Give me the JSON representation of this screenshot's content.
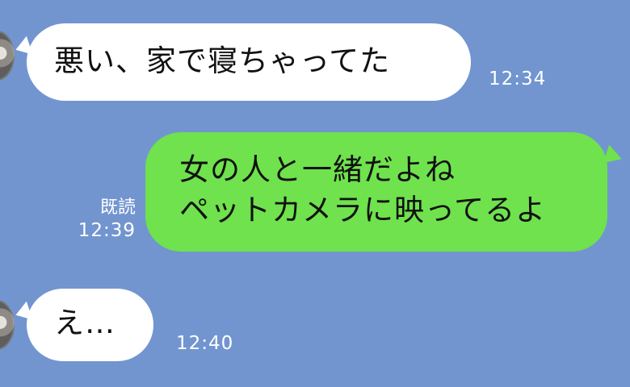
{
  "chat": {
    "messages": [
      {
        "direction": "incoming",
        "text": "悪い、家で寝ちゃってた",
        "time": "12:34"
      },
      {
        "direction": "outgoing",
        "lines": [
          "女の人と一緒だよね",
          "ペットカメラに映ってるよ"
        ],
        "read_label": "既読",
        "time": "12:39"
      },
      {
        "direction": "incoming",
        "text": "え…",
        "time": "12:40"
      }
    ]
  },
  "colors": {
    "background": "#7295d0",
    "incoming_bubble": "#ffffff",
    "outgoing_bubble": "#6fe24d",
    "meta_text": "#ffffff"
  },
  "icons": {
    "avatar": "user-avatar-icon"
  }
}
